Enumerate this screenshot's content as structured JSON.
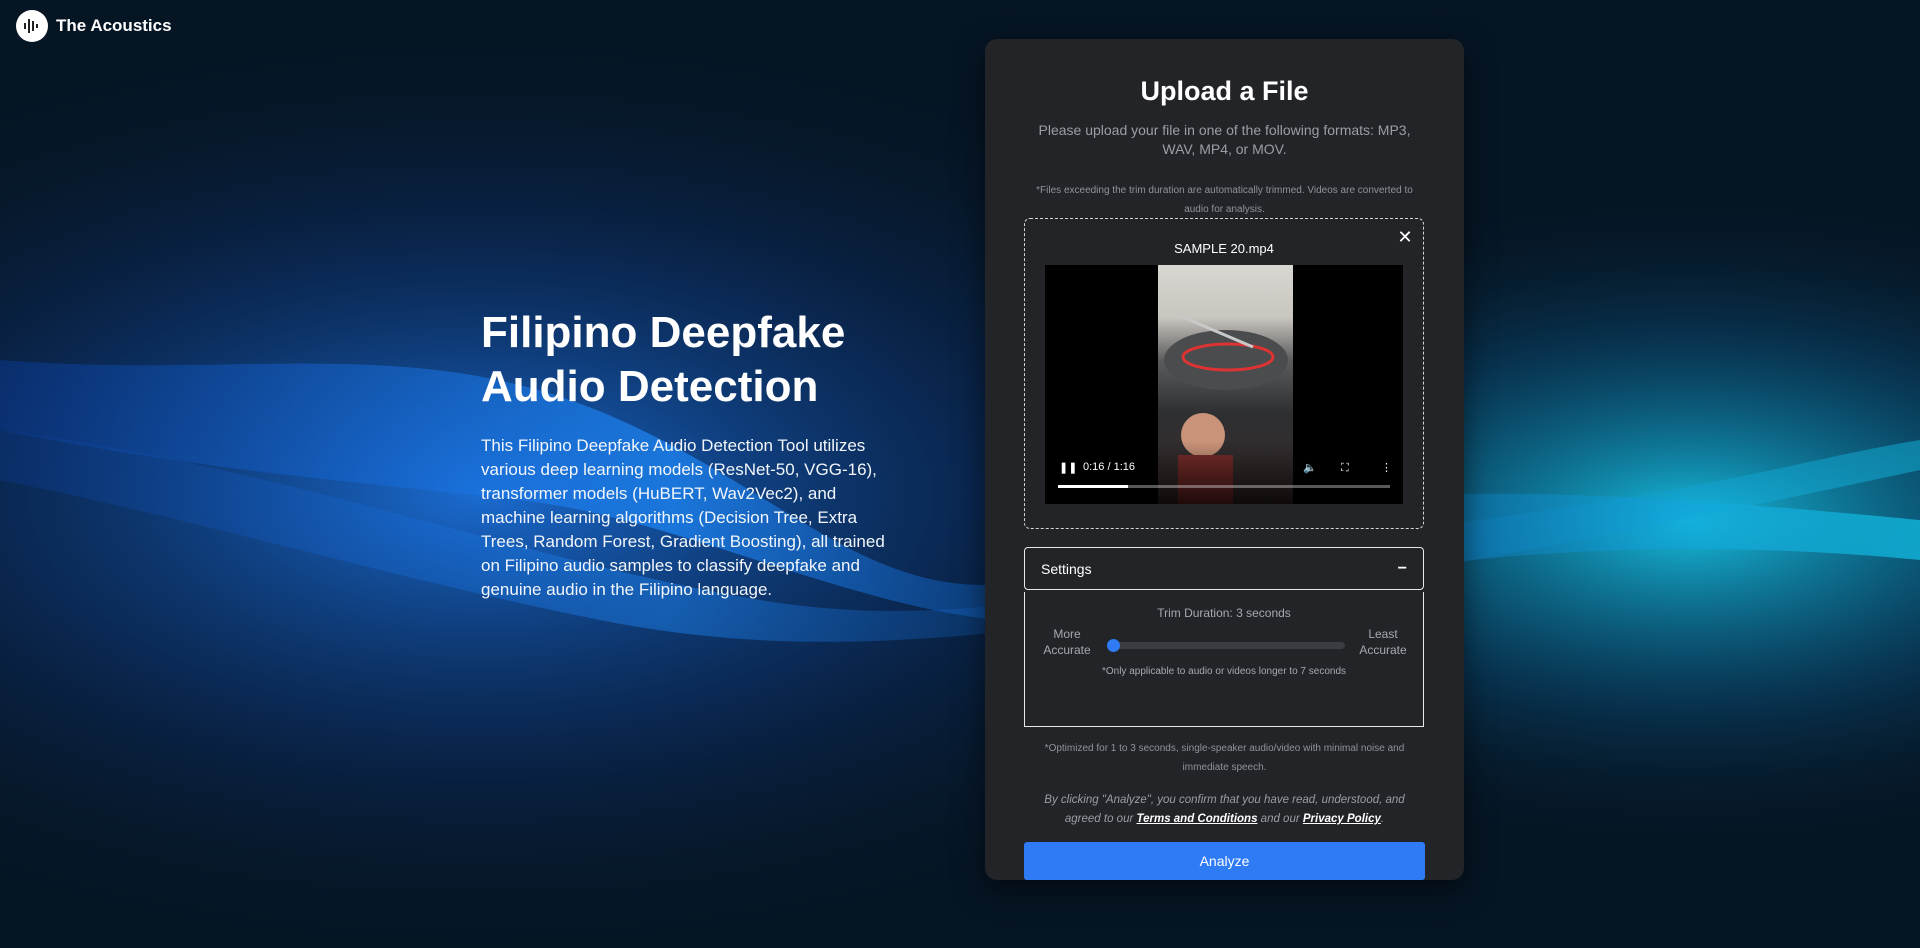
{
  "brand": {
    "name": "The Acoustics",
    "logo_icon": "sound-wave-icon"
  },
  "hero": {
    "title": "Filipino Deepfake Audio Detection",
    "description": "This Filipino Deepfake Audio Detection Tool utilizes various deep learning models (ResNet-50, VGG-16), transformer models (HuBERT, Wav2Vec2), and machine learning algorithms (Decision Tree, Extra Trees, Random Forest, Gradient Boosting), all trained on Filipino audio samples to classify deepfake and genuine audio in the Filipino language."
  },
  "upload": {
    "title": "Upload a File",
    "subtitle": "Please upload your file in one of the following formats: MP3, WAV, MP4, or MOV.",
    "note": "*Files exceeding the trim duration are automatically trimmed. Videos are converted to audio for analysis.",
    "file_name": "SAMPLE 20.mp4",
    "close_icon": "close-icon",
    "player": {
      "time": "0:16 / 1:16",
      "progress": 0.21,
      "play_icon": "pause-icon",
      "volume_icon": "volume-icon",
      "fullscreen_icon": "fullscreen-icon",
      "menu_icon": "more-vertical-icon"
    }
  },
  "settings": {
    "label": "Settings",
    "toggle": "−",
    "trim_label": "Trim Duration: 3 seconds",
    "left_label": "More Accurate",
    "right_label": "Least Accurate",
    "slider_value": 0.0,
    "slider_note": "*Only applicable to audio or videos longer to 7 seconds"
  },
  "opt_note": "*Optimized for 1 to 3 seconds, single-speaker audio/video with minimal noise and immediate speech.",
  "consent": {
    "prefix": "By clicking \"Analyze\", you confirm that you have read, understood, and agreed to our ",
    "terms": "Terms and Conditions",
    "middle": " and our ",
    "privacy": "Privacy Policy",
    "suffix": "."
  },
  "analyze_label": "Analyze",
  "colors": {
    "accent": "#2f7bf6",
    "card": "#222427",
    "background": "#061524"
  }
}
